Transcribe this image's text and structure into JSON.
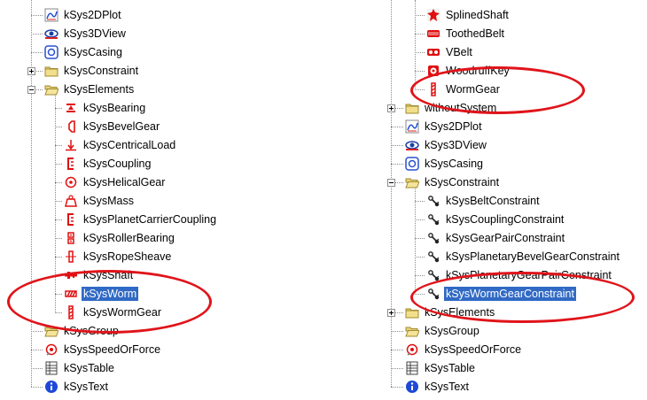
{
  "left_tree": {
    "items": [
      {
        "label": "kSys2DPlot",
        "icon": "plot-2d-icon"
      },
      {
        "label": "kSys3DView",
        "icon": "view-3d-icon"
      },
      {
        "label": "kSysCasing",
        "icon": "casing-icon"
      },
      {
        "label": "kSysConstraint",
        "icon": "folder-icon",
        "expander": "+"
      },
      {
        "label": "kSysElements",
        "icon": "folder-open-icon",
        "expander": "-"
      },
      {
        "label": "kSysBearing",
        "icon": "bearing-icon"
      },
      {
        "label": "kSysBevelGear",
        "icon": "bevel-gear-icon"
      },
      {
        "label": "kSysCentricalLoad",
        "icon": "centrical-load-icon"
      },
      {
        "label": "kSysCoupling",
        "icon": "coupling-icon"
      },
      {
        "label": "kSysHelicalGear",
        "icon": "helical-gear-icon"
      },
      {
        "label": "kSysMass",
        "icon": "mass-icon"
      },
      {
        "label": "kSysPlanetCarrierCoupling",
        "icon": "planet-carrier-coupling-icon"
      },
      {
        "label": "kSysRollerBearing",
        "icon": "roller-bearing-icon"
      },
      {
        "label": "kSysRopeSheave",
        "icon": "rope-sheave-icon"
      },
      {
        "label": "kSysShaft",
        "icon": "shaft-icon"
      },
      {
        "label": "kSysWorm",
        "icon": "worm-icon",
        "selected": true
      },
      {
        "label": "kSysWormGear",
        "icon": "worm-gear-icon"
      },
      {
        "label": "kSysGroup",
        "icon": "folder-open-icon"
      },
      {
        "label": "kSysSpeedOrForce",
        "icon": "speed-or-force-icon"
      },
      {
        "label": "kSysTable",
        "icon": "table-icon"
      },
      {
        "label": "kSysText",
        "icon": "info-icon"
      }
    ]
  },
  "right_tree": {
    "items": [
      {
        "label": "SplinedShaft",
        "icon": "splined-shaft-icon"
      },
      {
        "label": "ToothedBelt",
        "icon": "toothed-belt-icon"
      },
      {
        "label": "VBelt",
        "icon": "v-belt-icon"
      },
      {
        "label": "WoodruffKey",
        "icon": "woodruff-key-icon"
      },
      {
        "label": "WormGear",
        "icon": "worm-gear-icon"
      },
      {
        "label": "withoutSystem",
        "icon": "folder-icon",
        "expander": "+"
      },
      {
        "label": "kSys2DPlot",
        "icon": "plot-2d-icon"
      },
      {
        "label": "kSys3DView",
        "icon": "view-3d-icon"
      },
      {
        "label": "kSysCasing",
        "icon": "casing-icon"
      },
      {
        "label": "kSysConstraint",
        "icon": "folder-open-icon",
        "expander": "-"
      },
      {
        "label": "kSysBeltConstraint",
        "icon": "constraint-icon"
      },
      {
        "label": "kSysCouplingConstraint",
        "icon": "constraint-icon"
      },
      {
        "label": "kSysGearPairConstraint",
        "icon": "constraint-icon"
      },
      {
        "label": "kSysPlanetaryBevelGearConstraint",
        "icon": "constraint-icon"
      },
      {
        "label": "kSysPlanetaryGearPairConstraint",
        "icon": "constraint-icon"
      },
      {
        "label": "kSysWormGearConstraint",
        "icon": "constraint-icon",
        "selected": true
      },
      {
        "label": "kSysElements",
        "icon": "folder-icon",
        "expander": "+"
      },
      {
        "label": "kSysGroup",
        "icon": "folder-open-icon"
      },
      {
        "label": "kSysSpeedOrForce",
        "icon": "speed-or-force-icon"
      },
      {
        "label": "kSysTable",
        "icon": "table-icon"
      },
      {
        "label": "kSysText",
        "icon": "info-icon"
      }
    ]
  },
  "colors": {
    "selection": "#316ac5",
    "highlight_ellipse": "#e0141a",
    "folder": "#e8d37a"
  }
}
